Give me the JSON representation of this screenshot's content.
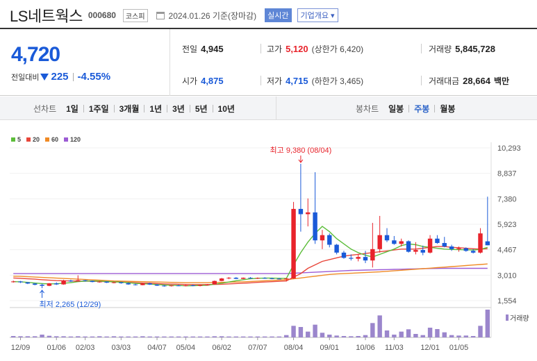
{
  "header": {
    "name": "LS네트웍스",
    "code": "000680",
    "market": "코스피",
    "date": "2024.01.26 기준(장마감)",
    "live_label": "실시간",
    "overview_label": "기업개요 ▾"
  },
  "price": {
    "current": "4,720",
    "change_label": "전일대비",
    "change": "225",
    "change_pct": "-4.55%",
    "prev_close_label": "전일",
    "prev_close": "4,945",
    "open_label": "시가",
    "open": "4,875",
    "high_label": "고가",
    "high": "5,120",
    "upper_limit": "(상한가 6,420)",
    "low_label": "저가",
    "low": "4,715",
    "lower_limit": "(하한가 3,465)",
    "volume_label": "거래량",
    "volume": "5,845,728",
    "value_label": "거래대금",
    "value": "28,664",
    "value_unit": "백만"
  },
  "periods": {
    "line_label": "선차트",
    "line_items": [
      "1일",
      "1주일",
      "3개월",
      "1년",
      "3년",
      "5년",
      "10년"
    ],
    "candle_label": "봉차트",
    "candle_items": [
      "일봉",
      "주봉",
      "월봉"
    ],
    "candle_selected": 1
  },
  "colors": {
    "up": "#e8232b",
    "down": "#1a5ad8",
    "ma5": "#5cbd3a",
    "ma20": "#e8463a",
    "ma60": "#f08a24",
    "ma120": "#9c5bd4",
    "volume": "#9b86cc"
  },
  "chart_data": {
    "type": "candlestick",
    "legend": [
      "5",
      "20",
      "60",
      "120"
    ],
    "y_ticks": [
      "10,293",
      "8,837",
      "7,380",
      "5,923",
      "4,467",
      "3,010",
      "1,554"
    ],
    "y_values": [
      10293,
      8837,
      7380,
      5923,
      4467,
      3010,
      1554
    ],
    "ylim": [
      1554,
      10293
    ],
    "x_ticks": [
      "12/09",
      "01/06",
      "02/03",
      "03/03",
      "04/07",
      "05/04",
      "06/02",
      "07/07",
      "08/04",
      "09/01",
      "10/06",
      "11/03",
      "12/01",
      "01/05"
    ],
    "annotations": {
      "high": "최고 9,380 (08/04)",
      "low": "최저 2,265 (12/29)"
    },
    "volume_label": "거래량",
    "candles": [
      [
        2620,
        2700,
        2580,
        2650
      ],
      [
        2650,
        2680,
        2560,
        2600
      ],
      [
        2600,
        2620,
        2500,
        2530
      ],
      [
        2530,
        2560,
        2430,
        2460
      ],
      [
        2460,
        2520,
        2265,
        2400
      ],
      [
        2400,
        2560,
        2380,
        2540
      ],
      [
        2540,
        2600,
        2450,
        2480
      ],
      [
        2480,
        2750,
        2460,
        2700
      ],
      [
        2700,
        2750,
        2620,
        2650
      ],
      [
        2650,
        3000,
        2640,
        2720
      ],
      [
        2720,
        2740,
        2640,
        2680
      ],
      [
        2680,
        2700,
        2600,
        2620
      ],
      [
        2620,
        2680,
        2580,
        2640
      ],
      [
        2640,
        2660,
        2560,
        2580
      ],
      [
        2580,
        2640,
        2540,
        2600
      ],
      [
        2600,
        2620,
        2520,
        2550
      ],
      [
        2550,
        2580,
        2460,
        2480
      ],
      [
        2480,
        2520,
        2420,
        2440
      ],
      [
        2440,
        2560,
        2430,
        2540
      ],
      [
        2540,
        2580,
        2450,
        2470
      ],
      [
        2470,
        2500,
        2390,
        2410
      ],
      [
        2410,
        2450,
        2350,
        2380
      ],
      [
        2380,
        2440,
        2360,
        2420
      ],
      [
        2420,
        2460,
        2380,
        2390
      ],
      [
        2390,
        2450,
        2370,
        2430
      ],
      [
        2430,
        2470,
        2380,
        2400
      ],
      [
        2400,
        2460,
        2370,
        2430
      ],
      [
        2430,
        2500,
        2410,
        2480
      ],
      [
        2480,
        2700,
        2470,
        2680
      ],
      [
        2680,
        2850,
        2660,
        2820
      ],
      [
        2820,
        2900,
        2780,
        2860
      ],
      [
        2860,
        2900,
        2780,
        2800
      ],
      [
        2800,
        2880,
        2780,
        2860
      ],
      [
        2860,
        2900,
        2800,
        2830
      ],
      [
        2830,
        2880,
        2790,
        2850
      ],
      [
        2850,
        2890,
        2800,
        2830
      ],
      [
        2830,
        2860,
        2780,
        2810
      ],
      [
        2810,
        2850,
        2770,
        2790
      ],
      [
        2790,
        2850,
        2650,
        2820
      ],
      [
        2820,
        7200,
        2800,
        6800
      ],
      [
        6800,
        9380,
        5500,
        6500
      ],
      [
        6500,
        7400,
        5800,
        6600
      ],
      [
        6600,
        8900,
        4800,
        5000
      ],
      [
        5000,
        5600,
        4500,
        5300
      ],
      [
        5300,
        5400,
        4600,
        4750
      ],
      [
        4750,
        4800,
        4200,
        4300
      ],
      [
        4300,
        4400,
        3950,
        4000
      ],
      [
        4000,
        4200,
        3850,
        3950
      ],
      [
        3950,
        4200,
        3800,
        4050
      ],
      [
        4050,
        4400,
        3700,
        3850
      ],
      [
        3850,
        6000,
        3450,
        4500
      ],
      [
        4500,
        6400,
        4300,
        5300
      ],
      [
        5300,
        5700,
        4900,
        5000
      ],
      [
        5000,
        5250,
        4750,
        4800
      ],
      [
        4800,
        5100,
        4650,
        4950
      ],
      [
        4950,
        5000,
        4300,
        4350
      ],
      [
        4350,
        4900,
        4200,
        4450
      ],
      [
        4450,
        4700,
        4150,
        4300
      ],
      [
        4300,
        5300,
        4250,
        5100
      ],
      [
        5100,
        5300,
        4800,
        4850
      ],
      [
        4850,
        5200,
        4600,
        4650
      ],
      [
        4650,
        4750,
        4400,
        4500
      ],
      [
        4500,
        4650,
        4350,
        4550
      ],
      [
        4550,
        4600,
        4350,
        4400
      ],
      [
        4400,
        4500,
        4250,
        4300
      ],
      [
        4300,
        5700,
        4250,
        5400
      ],
      [
        4945,
        7500,
        4715,
        4720
      ]
    ],
    "volume": [
      0.6,
      0.5,
      0.5,
      0.5,
      1.2,
      0.7,
      0.5,
      0.5,
      0.4,
      0.5,
      0.4,
      0.4,
      0.5,
      0.4,
      0.5,
      0.4,
      0.4,
      0.4,
      0.5,
      0.4,
      0.4,
      0.4,
      0.4,
      0.4,
      0.4,
      0.4,
      0.4,
      0.4,
      0.5,
      0.5,
      0.4,
      0.4,
      0.4,
      0.4,
      0.4,
      0.4,
      0.4,
      0.4,
      1.0,
      5.0,
      4.5,
      2.5,
      5.5,
      2.0,
      1.2,
      0.8,
      0.6,
      0.5,
      0.6,
      1.0,
      6.2,
      9.5,
      3.0,
      1.2,
      2.5,
      3.5,
      1.5,
      1.0,
      4.2,
      3.6,
      2.2,
      1.0,
      0.8,
      0.8,
      0.6,
      5.0,
      12.0
    ],
    "ma5": [
      2640,
      2630,
      2600,
      2560,
      2530,
      2510,
      2520,
      2550,
      2580,
      2640,
      2670,
      2680,
      2670,
      2650,
      2630,
      2610,
      2580,
      2540,
      2520,
      2500,
      2470,
      2450,
      2430,
      2420,
      2400,
      2410,
      2420,
      2430,
      2490,
      2550,
      2620,
      2690,
      2750,
      2800,
      2830,
      2840,
      2840,
      2830,
      2820,
      3600,
      4300,
      4900,
      5400,
      5800,
      5500,
      5100,
      4800,
      4500,
      4300,
      4150,
      4050,
      4200,
      4350,
      4500,
      4700,
      4800,
      4750,
      4650,
      4600,
      4550,
      4500,
      4480,
      4470,
      4460,
      4450,
      4480,
      4600
    ],
    "ma20": [
      2850,
      2830,
      2800,
      2780,
      2750,
      2720,
      2700,
      2690,
      2680,
      2670,
      2670,
      2660,
      2650,
      2640,
      2630,
      2620,
      2600,
      2580,
      2560,
      2550,
      2530,
      2510,
      2500,
      2490,
      2480,
      2470,
      2470,
      2470,
      2480,
      2490,
      2510,
      2530,
      2550,
      2570,
      2600,
      2620,
      2640,
      2660,
      2680,
      2900,
      3100,
      3400,
      3600,
      3800,
      3900,
      4000,
      4100,
      4150,
      4200,
      4250,
      4300,
      4350,
      4400,
      4450,
      4500,
      4500,
      4500,
      4550,
      4600,
      4650,
      4650,
      4600,
      4580,
      4550,
      4520,
      4500,
      4520
    ],
    "ma60": [
      2950,
      2940,
      2920,
      2900,
      2880,
      2860,
      2840,
      2820,
      2800,
      2780,
      2760,
      2740,
      2720,
      2700,
      2680,
      2670,
      2660,
      2650,
      2640,
      2630,
      2620,
      2610,
      2600,
      2590,
      2580,
      2580,
      2580,
      2580,
      2590,
      2600,
      2610,
      2620,
      2630,
      2650,
      2670,
      2690,
      2710,
      2730,
      2750,
      2800,
      2850,
      2900,
      2950,
      3000,
      3050,
      3080,
      3100,
      3120,
      3140,
      3160,
      3180,
      3200,
      3230,
      3260,
      3290,
      3320,
      3350,
      3380,
      3410,
      3440,
      3470,
      3500,
      3530,
      3560,
      3590,
      3620,
      3650
    ],
    "ma120": [
      3100,
      3100,
      3100,
      3100,
      3100,
      3100,
      3100,
      3100,
      3100,
      3100,
      3100,
      3100,
      3100,
      3100,
      3100,
      3100,
      3100,
      3100,
      3100,
      3100,
      3100,
      3100,
      3100,
      3100,
      3100,
      3100,
      3100,
      3100,
      3100,
      3100,
      3100,
      3100,
      3100,
      3100,
      3100,
      3100,
      3100,
      3100,
      3100,
      3120,
      3140,
      3160,
      3180,
      3200,
      3220,
      3240,
      3260,
      3280,
      3290,
      3300,
      3310,
      3320,
      3330,
      3340,
      3350,
      3360,
      3370,
      3380,
      3390,
      3395,
      3400,
      3400,
      3400,
      3400,
      3400,
      3400,
      3400
    ]
  }
}
